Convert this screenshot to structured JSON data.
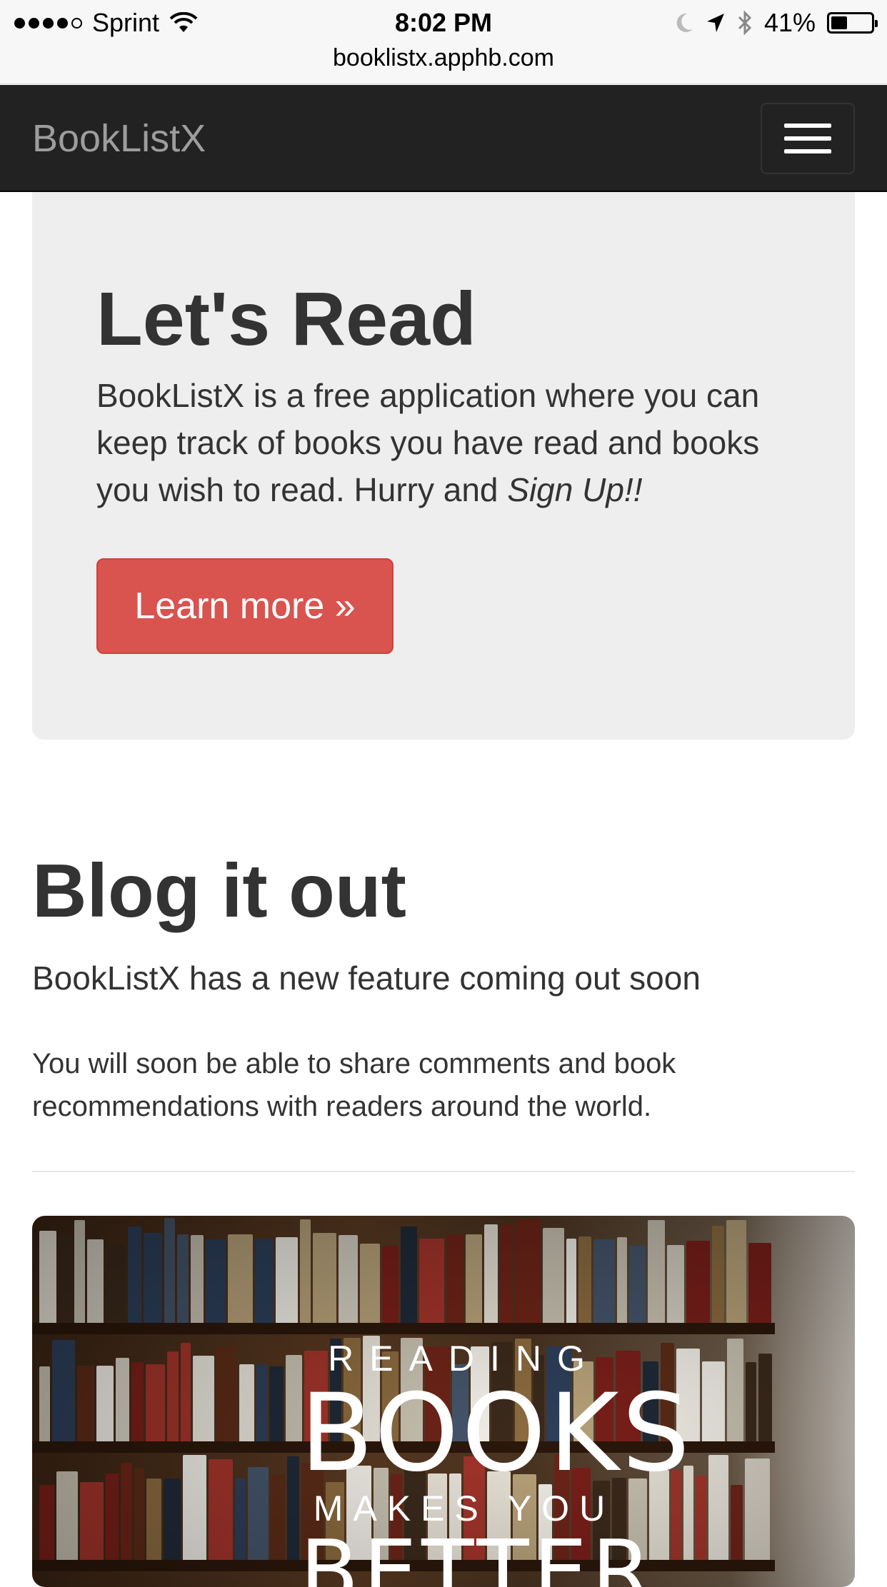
{
  "status_bar": {
    "carrier": "Sprint",
    "time": "8:02 PM",
    "battery": "41%",
    "battery_level": 0.41,
    "url": "booklistx.apphb.com"
  },
  "navbar": {
    "brand": "BookListX",
    "toggle_icon": "hamburger-menu-icon"
  },
  "jumbotron": {
    "title": "Let's Read",
    "text_before": "BookListX is a free application where you can keep track of books you have read and books you wish to read. Hurry and ",
    "text_emphasis": "Sign Up!!",
    "button_label": "Learn more »",
    "button_color": "#d9534f"
  },
  "blog": {
    "title": "Blog it out",
    "lead": "BookListX has a new feature coming out soon",
    "body": "You will soon be able to share comments and book recommendations with readers around the world."
  },
  "hero_image": {
    "line1": "READING",
    "line2": "BOOKS",
    "line3": "MAKES YOU",
    "line4": "BETTER"
  }
}
